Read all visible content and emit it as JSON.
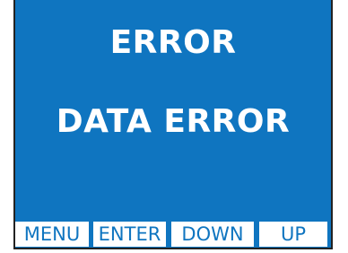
{
  "display": {
    "title": "ERROR",
    "message": "DATA ERROR"
  },
  "softkeys": [
    {
      "label": "MENU"
    },
    {
      "label": "ENTER"
    },
    {
      "label": "DOWN"
    },
    {
      "label": "UP"
    }
  ],
  "colors": {
    "screen_background": "#0f75c0",
    "text": "#ffffff",
    "softkey_background": "#ffffff",
    "softkey_text": "#0f75c0"
  }
}
